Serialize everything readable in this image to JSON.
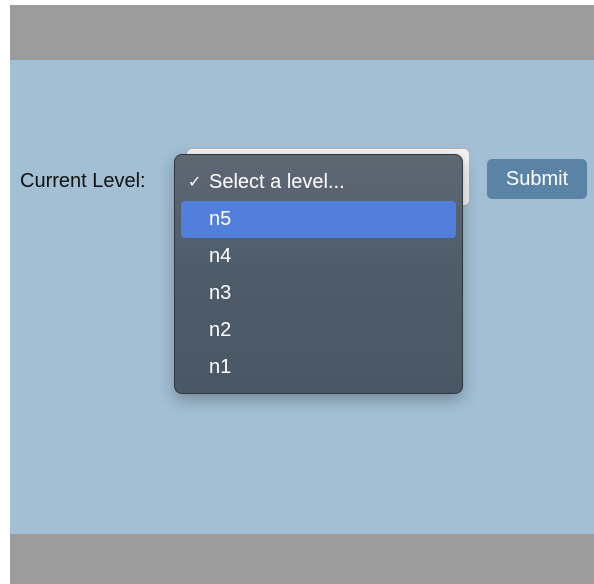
{
  "form": {
    "label": "Current Level:",
    "submit_label": "Submit"
  },
  "select": {
    "selected_label": "Select a level...",
    "checkmark": "✓",
    "caret": "⌄",
    "highlighted": "n5",
    "options": [
      "Select a level...",
      "n5",
      "n4",
      "n3",
      "n2",
      "n1"
    ]
  },
  "colors": {
    "top_bar": "#9c9c9c",
    "content_bg": "#a3bfd4",
    "submit_bg": "#5b83a5",
    "dropdown_bg": "#4e5c6a",
    "highlight": "#527fdc"
  }
}
